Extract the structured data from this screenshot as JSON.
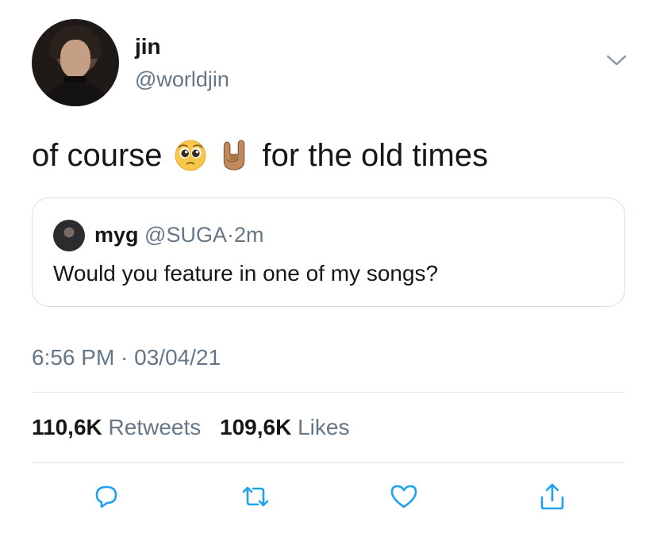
{
  "tweet": {
    "author": {
      "name": "jin",
      "handle": "@worldjin"
    },
    "text_before": "of course",
    "text_after": "for the old times",
    "emojis": [
      "pleading-face",
      "sign-of-the-horns-medium-skin-tone"
    ],
    "quoted": {
      "name": "myg",
      "handle": "@SUGA",
      "separator": "·",
      "time": "2m",
      "text": "Would you feature in one of my songs?"
    },
    "timestamp": "6:56 PM · 03/04/21",
    "stats": {
      "retweets_count": "110,6K",
      "retweets_label": "Retweets",
      "likes_count": "109,6K",
      "likes_label": "Likes"
    }
  },
  "actions": [
    "reply-icon",
    "retweet-icon",
    "like-icon",
    "share-icon"
  ],
  "colors": {
    "text": "#14171a",
    "secondary": "#657786",
    "icon": "#1da1f2",
    "border": "#d8dee2"
  }
}
